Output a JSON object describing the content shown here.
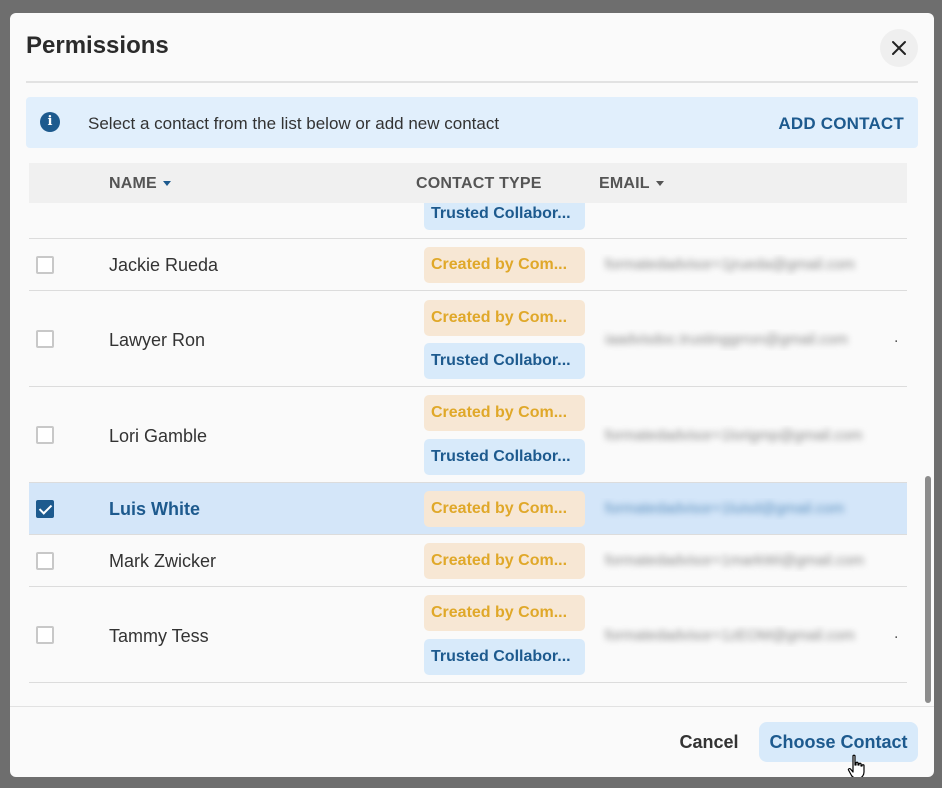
{
  "modal": {
    "title": "Permissions",
    "close_icon": "close-icon"
  },
  "banner": {
    "icon": "info-icon",
    "icon_glyph": "i",
    "text": "Select a contact from the list below or add new contact",
    "add_contact_label": "ADD CONTACT"
  },
  "table": {
    "columns": {
      "name": "NAME",
      "contact_type": "CONTACT TYPE",
      "email": "EMAIL"
    },
    "partial_row": {
      "badges": [
        "Trusted Collabor..."
      ]
    },
    "rows": [
      {
        "name": "Jackie Rueda",
        "checked": false,
        "badges": [
          "Created by Com..."
        ],
        "email": "formatedadvisor+1jrueda@gmail.com"
      },
      {
        "name": "Lawyer Ron",
        "checked": false,
        "badges": [
          "Created by Com...",
          "Trusted Collabor..."
        ],
        "email": "iaadvisdoc.trustinggrron@gmail.com",
        "email_trailing": "."
      },
      {
        "name": "Lori Gamble",
        "checked": false,
        "badges": [
          "Created by Com...",
          "Trusted Collabor..."
        ],
        "email": "formatedadvisor+1lorigmp@gmail.com"
      },
      {
        "name": "Luis White",
        "checked": true,
        "selected": true,
        "badges": [
          "Created by Com..."
        ],
        "email": "formatedadvisor+1luisd@gmail.com"
      },
      {
        "name": "Mark Zwicker",
        "checked": false,
        "badges": [
          "Created by Com..."
        ],
        "email": "formatedadvisor+1markWi@gmail.com"
      },
      {
        "name": "Tammy Tess",
        "checked": false,
        "badges": [
          "Created by Com...",
          "Trusted Collabor..."
        ],
        "email": "formatedadvisor+1zEOM@gmail.com",
        "email_trailing": "."
      }
    ]
  },
  "footer": {
    "cancel_label": "Cancel",
    "choose_label": "Choose Contact"
  },
  "colors": {
    "accent": "#1d5a8e",
    "created_badge_bg": "#f7e7d4",
    "created_badge_text": "#e0a829",
    "trusted_badge_bg": "#d8eafa",
    "selected_row_bg": "#d4e6f9"
  }
}
